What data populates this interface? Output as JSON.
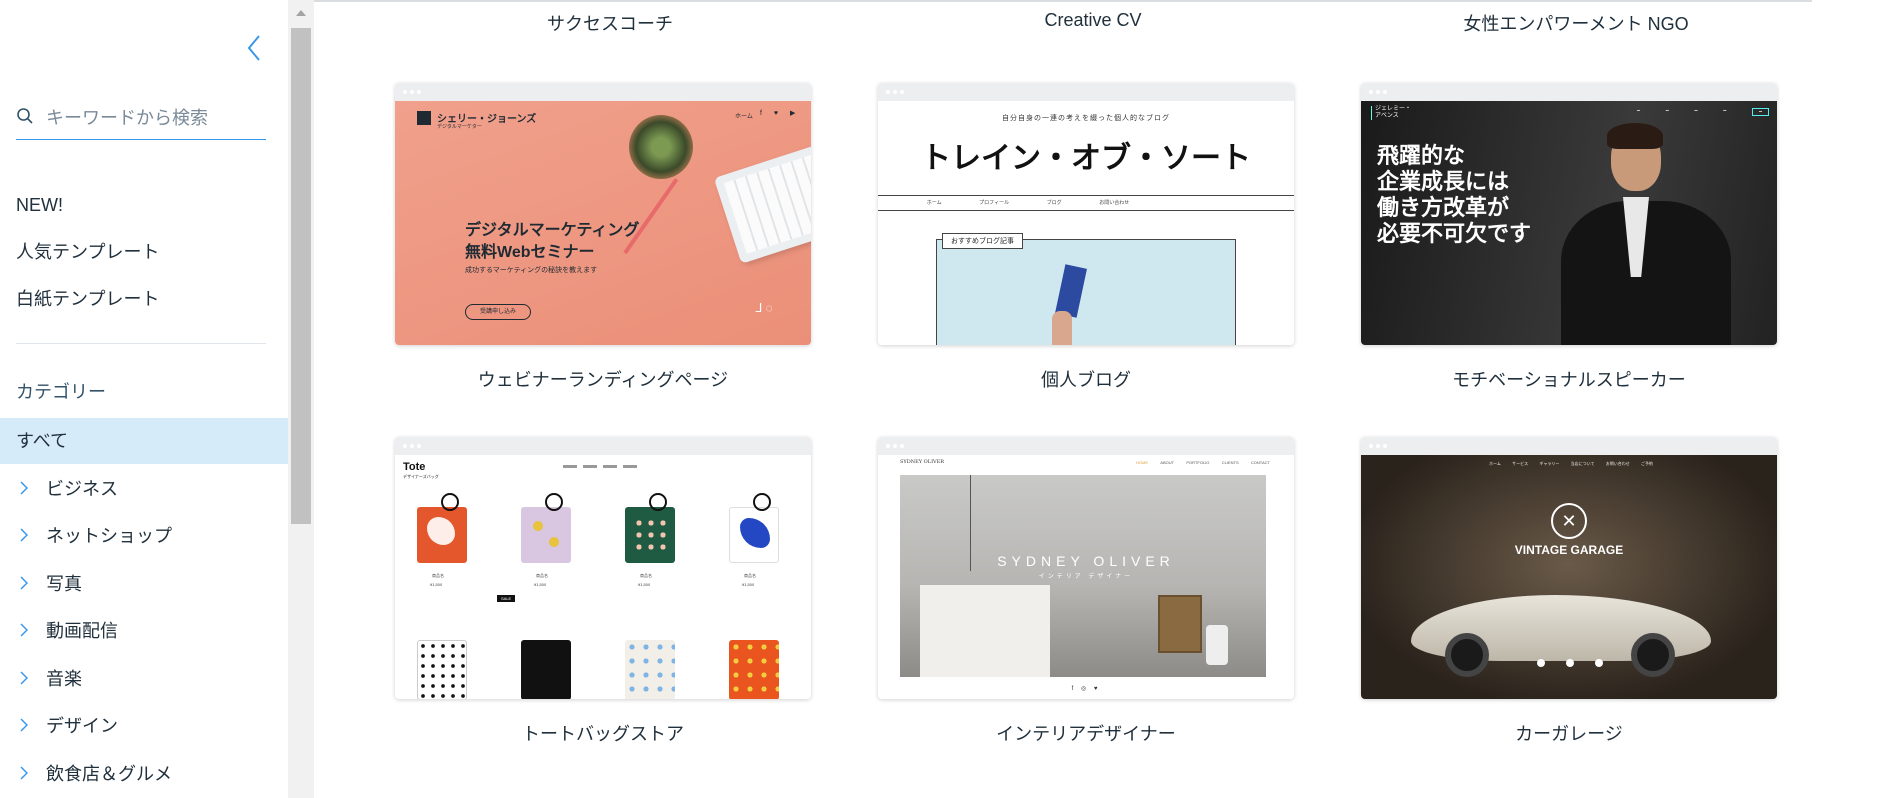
{
  "sidebar": {
    "search_placeholder": "キーワードから検索",
    "quick_links": [
      "NEW!",
      "人気テンプレート",
      "白紙テンプレート"
    ],
    "category_title": "カテゴリー",
    "selected_category": "すべて",
    "categories": [
      "ビジネス",
      "ネットショップ",
      "写真",
      "動画配信",
      "音楽",
      "デザイン",
      "飲食店＆グルメ"
    ]
  },
  "top_row_labels": [
    "サクセスコーチ",
    "Creative CV",
    "女性エンパワーメント NGO"
  ],
  "templates": [
    {
      "label": "ウェビナーランディングページ",
      "preview": {
        "brand": "シェリー・ジョーンズ",
        "brand_sub": "デジタルマーケター",
        "nav": "ホーム",
        "headline_1": "デジタルマーケティング",
        "headline_2": "無料Webセミナー",
        "subtext": "成功するマーケティングの秘訣を教えます",
        "cta": "受講申し込み"
      }
    },
    {
      "label": "個人ブログ",
      "preview": {
        "tagline": "自分自身の一連の考えを綴った個人的なブログ",
        "title": "トレイン・オブ・ソート",
        "nav": [
          "ホーム",
          "プロフィール",
          "ブログ",
          "お問い合わせ"
        ],
        "badge": "おすすめブログ記事"
      }
    },
    {
      "label": "モチベーショナルスピーカー",
      "preview": {
        "brand": "ジェレミー・アベンス",
        "headline": [
          "飛躍的な",
          "企業成長には",
          "働き方改革が",
          "必要不可欠です"
        ]
      }
    },
    {
      "label": "トートバッグストア",
      "preview": {
        "brand": "Tote",
        "brand_sub": "デザイナーズバッグ",
        "product_name": "商品名",
        "product_price": "¥1,500",
        "sale_badge": "SALE"
      }
    },
    {
      "label": "インテリアデザイナー",
      "preview": {
        "brand": "SYDNEY OLIVER",
        "nav": [
          "HOME",
          "ABOUT",
          "PORTFOLIO",
          "CLIENTS",
          "CONTACT"
        ],
        "hero_title": "SYDNEY OLIVER",
        "hero_sub": "インテリア デザイナー"
      }
    },
    {
      "label": "カーガレージ",
      "preview": {
        "nav": [
          "ホーム",
          "サービス",
          "ギャラリー",
          "当店について",
          "お問い合わせ",
          "ご予約"
        ],
        "title": "VINTAGE GARAGE"
      }
    }
  ],
  "colors": {
    "accent": "#3899ec",
    "selected_bg": "#d6ebfa",
    "text": "#20303c"
  }
}
